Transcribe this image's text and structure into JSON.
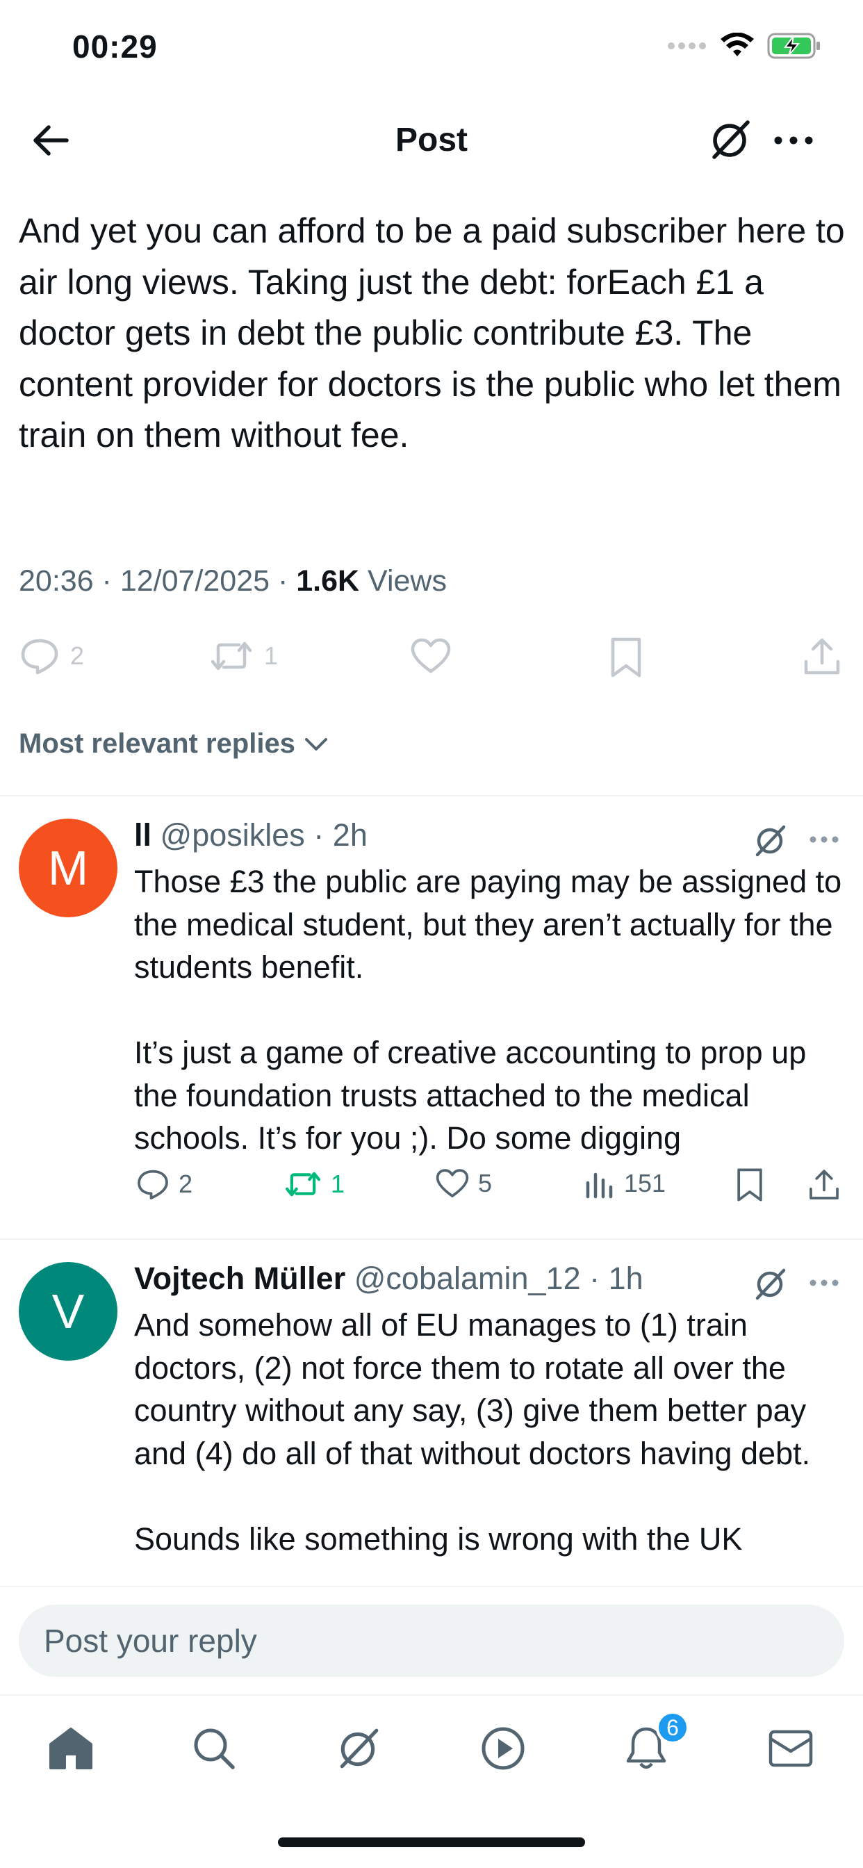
{
  "status": {
    "time": "00:29"
  },
  "nav": {
    "title": "Post"
  },
  "post": {
    "text": "And yet you can afford to be a paid subscriber here to air long views.  Taking just the debt: forEach £1 a doctor gets in debt the public contribute £3.  The content provider for doctors is the public who let them train on them without fee.",
    "timestamp": "20:36 · 12/07/2025 · ",
    "views_count": "1.6K",
    "views_label": " Views",
    "reply_count": "2",
    "repost_count": "1"
  },
  "sort": {
    "label": "Most relevant replies"
  },
  "replies": [
    {
      "avatar_letter": "M",
      "avatar_color": "#f4511e",
      "name": "ll",
      "handle": "@posikles",
      "time": " · 2h",
      "text": "Those £3 the public are paying may be assigned to the medical student, but they aren’t actually for the students benefit.\n\nIt’s just a game of creative accounting to prop up the foundation trusts attached to the medical schools. It’s for you ;). Do some digging",
      "replies": "2",
      "reposts": "1",
      "likes": "5",
      "views": "151"
    },
    {
      "avatar_letter": "V",
      "avatar_color": "#00897b",
      "name": "Vojtech Müller",
      "handle": "@cobalamin_12",
      "time": " · 1h",
      "text": "And somehow all of EU manages to (1) train doctors, (2) not force them to rotate all over the country without any say, (3) give them better pay and (4) do all of that without doctors having debt.\n\nSounds like something is wrong with the UK"
    }
  ],
  "composer": {
    "placeholder": "Post your reply"
  },
  "tabs": {
    "notifications_badge": "6"
  },
  "colors": {
    "repost_active": "#00ba7c",
    "accent": "#1d9bf0",
    "secondary_text": "#536471"
  }
}
